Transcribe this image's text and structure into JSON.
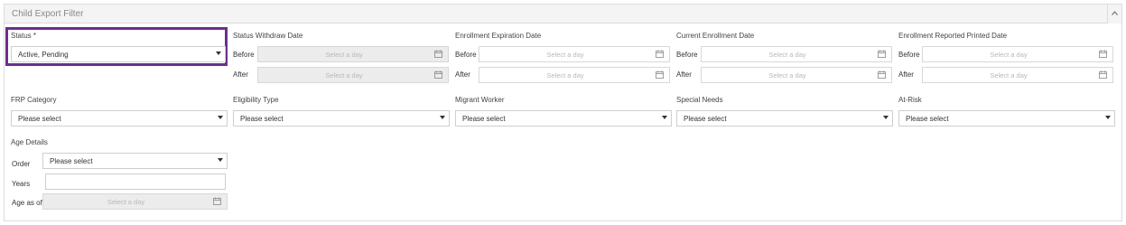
{
  "panel": {
    "title": "Child Export Filter",
    "collapse_icon": "chevron-up-icon"
  },
  "status": {
    "label": "Status *",
    "value": "Active, Pending"
  },
  "date_groups": [
    {
      "label": "Status Withdraw Date",
      "before": "Before",
      "after": "After",
      "placeholder": "Select a day"
    },
    {
      "label": "Enrollment Expiration Date",
      "before": "Before",
      "after": "After",
      "placeholder": "Select a day"
    },
    {
      "label": "Current Enrollment Date",
      "before": "Before",
      "after": "After",
      "placeholder": "Select a day"
    },
    {
      "label": "Enrollment Reported Printed Date",
      "before": "Before",
      "after": "After",
      "placeholder": "Select a day"
    }
  ],
  "selects": [
    {
      "label": "FRP Category",
      "value": "Please select"
    },
    {
      "label": "Eligibility Type",
      "value": "Please select"
    },
    {
      "label": "Migrant Worker",
      "value": "Please select"
    },
    {
      "label": "Special Needs",
      "value": "Please select"
    },
    {
      "label": "At-Risk",
      "value": "Please select"
    }
  ],
  "age_details": {
    "label": "Age Details",
    "order_label": "Order",
    "order_value": "Please select",
    "years_label": "Years",
    "years_value": "",
    "age_as_of_label": "Age as of",
    "age_as_of_placeholder": "Select a day"
  },
  "colors": {
    "highlight_border": "#6a2f8f",
    "disabled_bg": "#ececec"
  }
}
